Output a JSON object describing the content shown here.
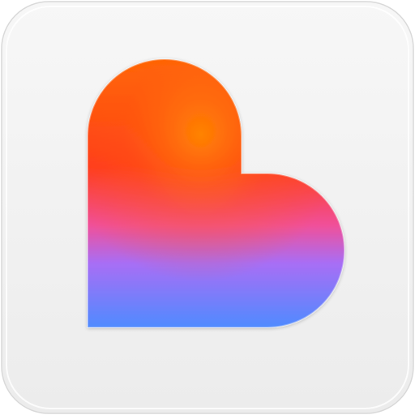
{
  "icon": {
    "name": "heart-icon",
    "background_color": "#f1f1f1",
    "gradient_colors": {
      "top": "#ff6a00",
      "upper_middle": "#ff3a1e",
      "middle": "#f0509a",
      "lower_middle": "#a86ef5",
      "bottom": "#4f8bff"
    }
  }
}
